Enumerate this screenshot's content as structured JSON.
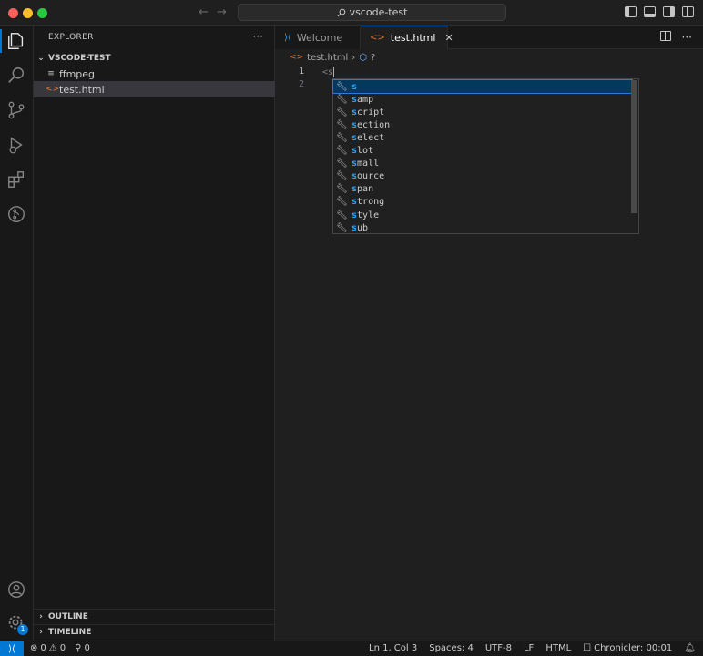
{
  "window": {
    "title": "vscode-test"
  },
  "titlebar": {
    "back_icon": "arrow-left-icon",
    "forward_icon": "arrow-right-icon",
    "search_icon": "search-icon"
  },
  "activitybar": {
    "items": [
      {
        "name": "explorer",
        "icon": "files-icon",
        "active": true
      },
      {
        "name": "search",
        "icon": "search-icon"
      },
      {
        "name": "source-control",
        "icon": "git-branch-icon"
      },
      {
        "name": "run-debug",
        "icon": "play-bug-icon"
      },
      {
        "name": "extensions",
        "icon": "extensions-icon"
      },
      {
        "name": "remote",
        "icon": "remote-icon"
      }
    ],
    "account_icon": "account-icon",
    "manage_icon": "gear-icon",
    "manage_badge": "1"
  },
  "sidebar": {
    "header": "EXPLORER",
    "more": "···",
    "folder": "VSCODE-TEST",
    "files": [
      {
        "name": "ffmpeg",
        "type": "generic"
      },
      {
        "name": "test.html",
        "type": "html",
        "selected": true
      }
    ],
    "outline": "OUTLINE",
    "timeline": "TIMELINE"
  },
  "tabs": [
    {
      "label": "Welcome",
      "icon": "vscode-icon"
    },
    {
      "label": "test.html",
      "icon": "html-icon",
      "active": true
    }
  ],
  "breadcrumb": {
    "file": "test.html",
    "symbol": "?"
  },
  "editor": {
    "lines": [
      {
        "number": "1",
        "text": "<s"
      },
      {
        "number": "2",
        "text": ""
      }
    ]
  },
  "suggestions": {
    "typed": "s",
    "items": [
      "s",
      "samp",
      "script",
      "section",
      "select",
      "slot",
      "small",
      "source",
      "span",
      "strong",
      "style",
      "sub"
    ],
    "selected_index": 0
  },
  "statusbar": {
    "errors": "0",
    "warnings": "0",
    "ports": "0",
    "position": "Ln 1, Col 3",
    "spaces": "Spaces: 4",
    "encoding": "UTF-8",
    "eol": "LF",
    "language": "HTML",
    "chronicler": "Chronicler: 00:01"
  },
  "colors": {
    "accent": "#0078d4",
    "html_icon": "#e37933",
    "suggest_highlight": "#2aaaff"
  }
}
